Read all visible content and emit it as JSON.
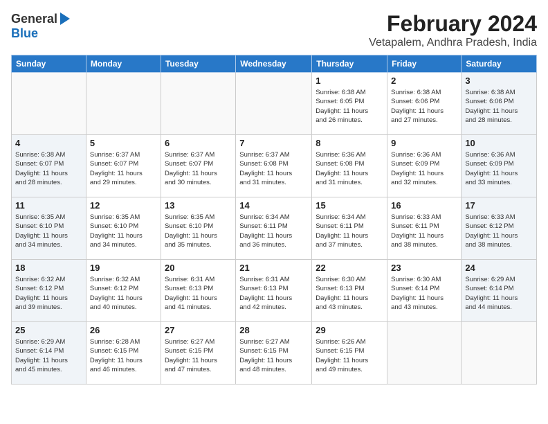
{
  "header": {
    "logo_general": "General",
    "logo_blue": "Blue",
    "month_year": "February 2024",
    "location": "Vetapalem, Andhra Pradesh, India"
  },
  "weekdays": [
    "Sunday",
    "Monday",
    "Tuesday",
    "Wednesday",
    "Thursday",
    "Friday",
    "Saturday"
  ],
  "weeks": [
    {
      "days": [
        {
          "num": "",
          "info": ""
        },
        {
          "num": "",
          "info": ""
        },
        {
          "num": "",
          "info": ""
        },
        {
          "num": "",
          "info": ""
        },
        {
          "num": "1",
          "info": "Sunrise: 6:38 AM\nSunset: 6:05 PM\nDaylight: 11 hours\nand 26 minutes."
        },
        {
          "num": "2",
          "info": "Sunrise: 6:38 AM\nSunset: 6:06 PM\nDaylight: 11 hours\nand 27 minutes."
        },
        {
          "num": "3",
          "info": "Sunrise: 6:38 AM\nSunset: 6:06 PM\nDaylight: 11 hours\nand 28 minutes."
        }
      ]
    },
    {
      "days": [
        {
          "num": "4",
          "info": "Sunrise: 6:38 AM\nSunset: 6:07 PM\nDaylight: 11 hours\nand 28 minutes."
        },
        {
          "num": "5",
          "info": "Sunrise: 6:37 AM\nSunset: 6:07 PM\nDaylight: 11 hours\nand 29 minutes."
        },
        {
          "num": "6",
          "info": "Sunrise: 6:37 AM\nSunset: 6:07 PM\nDaylight: 11 hours\nand 30 minutes."
        },
        {
          "num": "7",
          "info": "Sunrise: 6:37 AM\nSunset: 6:08 PM\nDaylight: 11 hours\nand 31 minutes."
        },
        {
          "num": "8",
          "info": "Sunrise: 6:36 AM\nSunset: 6:08 PM\nDaylight: 11 hours\nand 31 minutes."
        },
        {
          "num": "9",
          "info": "Sunrise: 6:36 AM\nSunset: 6:09 PM\nDaylight: 11 hours\nand 32 minutes."
        },
        {
          "num": "10",
          "info": "Sunrise: 6:36 AM\nSunset: 6:09 PM\nDaylight: 11 hours\nand 33 minutes."
        }
      ]
    },
    {
      "days": [
        {
          "num": "11",
          "info": "Sunrise: 6:35 AM\nSunset: 6:10 PM\nDaylight: 11 hours\nand 34 minutes."
        },
        {
          "num": "12",
          "info": "Sunrise: 6:35 AM\nSunset: 6:10 PM\nDaylight: 11 hours\nand 34 minutes."
        },
        {
          "num": "13",
          "info": "Sunrise: 6:35 AM\nSunset: 6:10 PM\nDaylight: 11 hours\nand 35 minutes."
        },
        {
          "num": "14",
          "info": "Sunrise: 6:34 AM\nSunset: 6:11 PM\nDaylight: 11 hours\nand 36 minutes."
        },
        {
          "num": "15",
          "info": "Sunrise: 6:34 AM\nSunset: 6:11 PM\nDaylight: 11 hours\nand 37 minutes."
        },
        {
          "num": "16",
          "info": "Sunrise: 6:33 AM\nSunset: 6:11 PM\nDaylight: 11 hours\nand 38 minutes."
        },
        {
          "num": "17",
          "info": "Sunrise: 6:33 AM\nSunset: 6:12 PM\nDaylight: 11 hours\nand 38 minutes."
        }
      ]
    },
    {
      "days": [
        {
          "num": "18",
          "info": "Sunrise: 6:32 AM\nSunset: 6:12 PM\nDaylight: 11 hours\nand 39 minutes."
        },
        {
          "num": "19",
          "info": "Sunrise: 6:32 AM\nSunset: 6:12 PM\nDaylight: 11 hours\nand 40 minutes."
        },
        {
          "num": "20",
          "info": "Sunrise: 6:31 AM\nSunset: 6:13 PM\nDaylight: 11 hours\nand 41 minutes."
        },
        {
          "num": "21",
          "info": "Sunrise: 6:31 AM\nSunset: 6:13 PM\nDaylight: 11 hours\nand 42 minutes."
        },
        {
          "num": "22",
          "info": "Sunrise: 6:30 AM\nSunset: 6:13 PM\nDaylight: 11 hours\nand 43 minutes."
        },
        {
          "num": "23",
          "info": "Sunrise: 6:30 AM\nSunset: 6:14 PM\nDaylight: 11 hours\nand 43 minutes."
        },
        {
          "num": "24",
          "info": "Sunrise: 6:29 AM\nSunset: 6:14 PM\nDaylight: 11 hours\nand 44 minutes."
        }
      ]
    },
    {
      "days": [
        {
          "num": "25",
          "info": "Sunrise: 6:29 AM\nSunset: 6:14 PM\nDaylight: 11 hours\nand 45 minutes."
        },
        {
          "num": "26",
          "info": "Sunrise: 6:28 AM\nSunset: 6:15 PM\nDaylight: 11 hours\nand 46 minutes."
        },
        {
          "num": "27",
          "info": "Sunrise: 6:27 AM\nSunset: 6:15 PM\nDaylight: 11 hours\nand 47 minutes."
        },
        {
          "num": "28",
          "info": "Sunrise: 6:27 AM\nSunset: 6:15 PM\nDaylight: 11 hours\nand 48 minutes."
        },
        {
          "num": "29",
          "info": "Sunrise: 6:26 AM\nSunset: 6:15 PM\nDaylight: 11 hours\nand 49 minutes."
        },
        {
          "num": "",
          "info": ""
        },
        {
          "num": "",
          "info": ""
        }
      ]
    }
  ]
}
